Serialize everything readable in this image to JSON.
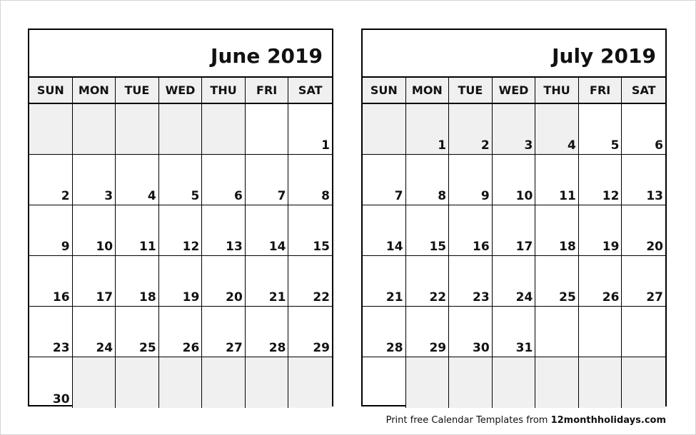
{
  "weekdays": [
    "SUN",
    "MON",
    "TUE",
    "WED",
    "THU",
    "FRI",
    "SAT"
  ],
  "calendars": [
    {
      "id": "june",
      "title": "June 2019",
      "weeks": [
        [
          "",
          "",
          "",
          "",
          "",
          "",
          "1"
        ],
        [
          "2",
          "3",
          "4",
          "5",
          "6",
          "7",
          "8"
        ],
        [
          "9",
          "10",
          "11",
          "12",
          "13",
          "14",
          "15"
        ],
        [
          "16",
          "17",
          "18",
          "19",
          "20",
          "21",
          "22"
        ],
        [
          "23",
          "24",
          "25",
          "26",
          "27",
          "28",
          "29"
        ],
        [
          "30",
          "",
          "",
          "",
          "",
          "",
          ""
        ]
      ],
      "shaded": [
        [
          true,
          true,
          true,
          true,
          true,
          false,
          false
        ],
        [
          false,
          false,
          false,
          false,
          false,
          false,
          false
        ],
        [
          false,
          false,
          false,
          false,
          false,
          false,
          false
        ],
        [
          false,
          false,
          false,
          false,
          false,
          false,
          false
        ],
        [
          false,
          false,
          false,
          false,
          false,
          false,
          false
        ],
        [
          false,
          true,
          true,
          true,
          true,
          true,
          true
        ]
      ]
    },
    {
      "id": "july",
      "title": "July 2019",
      "weeks": [
        [
          "",
          "1",
          "2",
          "3",
          "4",
          "5",
          "6"
        ],
        [
          "7",
          "8",
          "9",
          "10",
          "11",
          "12",
          "13"
        ],
        [
          "14",
          "15",
          "16",
          "17",
          "18",
          "19",
          "20"
        ],
        [
          "21",
          "22",
          "23",
          "24",
          "25",
          "26",
          "27"
        ],
        [
          "28",
          "29",
          "30",
          "31",
          "",
          "",
          ""
        ],
        [
          "",
          "",
          "",
          "",
          "",
          "",
          ""
        ]
      ],
      "shaded": [
        [
          true,
          true,
          true,
          true,
          true,
          false,
          false
        ],
        [
          false,
          false,
          false,
          false,
          false,
          false,
          false
        ],
        [
          false,
          false,
          false,
          false,
          false,
          false,
          false
        ],
        [
          false,
          false,
          false,
          false,
          false,
          false,
          false
        ],
        [
          false,
          false,
          false,
          false,
          false,
          false,
          false
        ],
        [
          false,
          true,
          true,
          true,
          true,
          true,
          true
        ]
      ]
    }
  ],
  "footer": {
    "text": "Print free Calendar Templates from ",
    "site": "12monthholidays.com"
  }
}
